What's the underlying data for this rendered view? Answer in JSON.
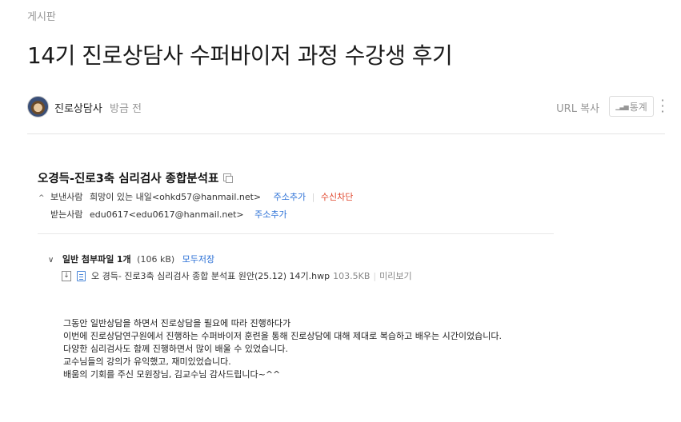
{
  "breadcrumb": {
    "category": "게시판"
  },
  "post": {
    "title": "14기 진로상담사 수퍼바이저 과정 수강생 후기",
    "author": "진로상담사",
    "time": "방금 전"
  },
  "toolbar": {
    "url_copy": "URL 복사",
    "stats_icon": "bar-chart-icon",
    "stats": "통계",
    "more_icon": "more-vertical-icon"
  },
  "mail": {
    "subject": "오경득-진로3축 심리검사 종합분석표",
    "sender_label": "보낸사람",
    "sender": "희망이 있는 내일<ohkd57@hanmail.net>",
    "add_address": "주소추가",
    "block": "수신차단",
    "receiver_label": "받는사람",
    "receiver": "edu0617<edu0617@hanmail.net>",
    "receiver_add_address": "주소추가",
    "attachments": {
      "kind": "일반 첨부파일",
      "count": "1개",
      "total_size": "(106 kB)",
      "save_all": "모두저장",
      "files": [
        {
          "name": "오 경득- 진로3축 심리검사 종합 분석표 원안(25.12) 14기.hwp",
          "size": "103.5KB",
          "preview": "미리보기"
        }
      ]
    },
    "body": [
      "그동안 일반상담을 하면서 진로상담을 필요에 따라 진행하다가",
      "이번에 진로상담연구원에서 진행하는 수퍼바이저 훈련을 통해 진로상담에 대해 제대로 복습하고 배우는 시간이었습니다.",
      "다양한 심리검사도 함께 진행하면서  많이 배울 수 있었습니다.",
      "교수님들의 강의가 유익했고, 재미있었습니다.",
      "배움의 기회를 주신 모원장님, 김교수님 감사드립니다~^^"
    ]
  }
}
